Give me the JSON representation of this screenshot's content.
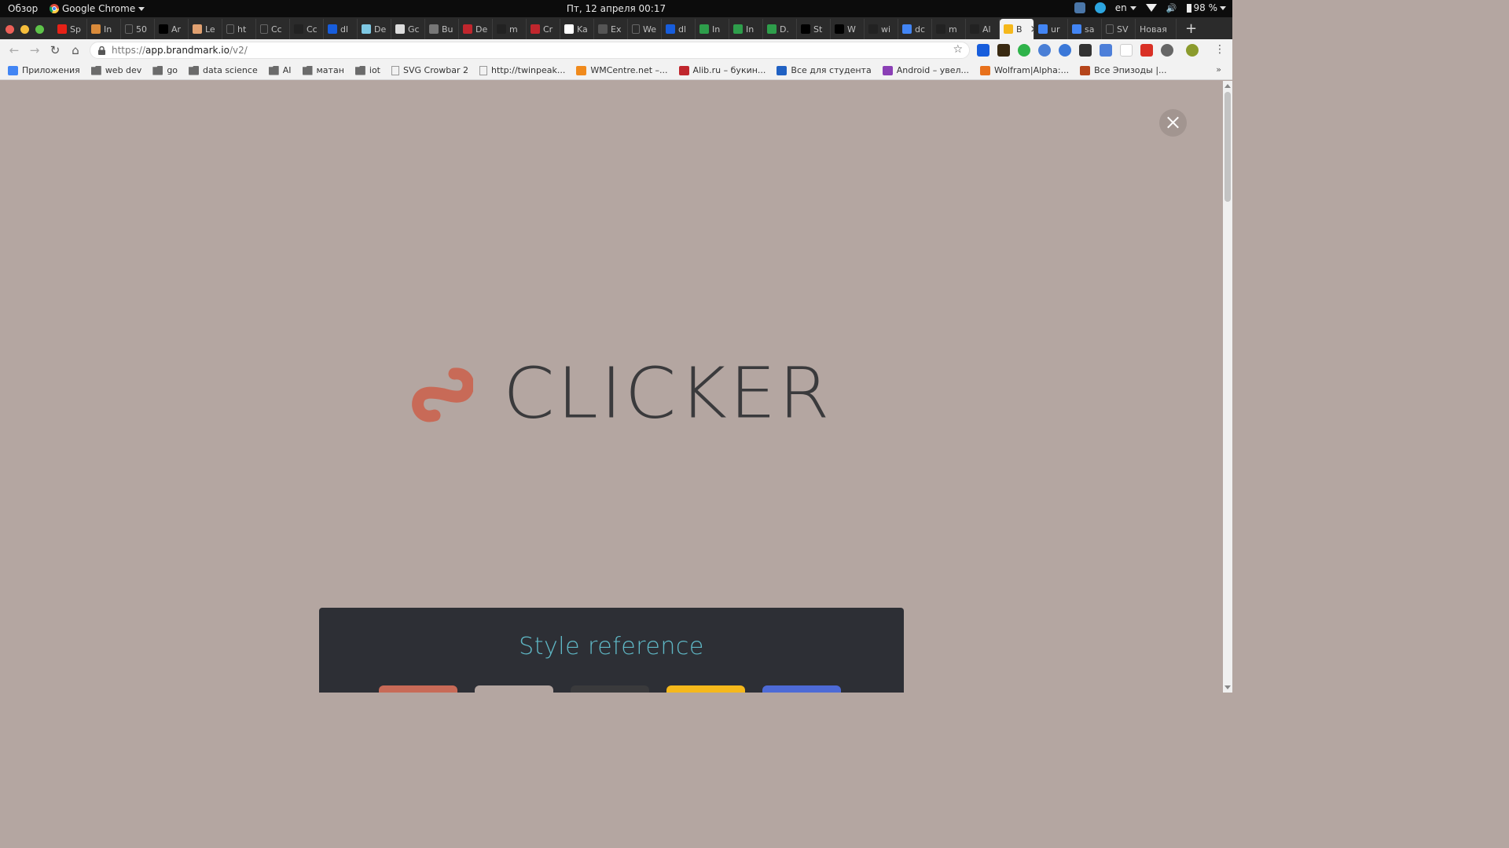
{
  "os": {
    "overview_label": "Обзор",
    "app_name": "Google Chrome",
    "clock": "Пт, 12 апреля  00:17",
    "tray": {
      "lang": "en",
      "battery": "98 %"
    }
  },
  "tabs": [
    {
      "label": "Sp",
      "icon": "youtube-icon",
      "color": "#e62117"
    },
    {
      "label": "In",
      "icon": "emoji-icon",
      "color": "#d98a3a"
    },
    {
      "label": "50",
      "icon": "page-icon",
      "color": "#666666"
    },
    {
      "label": "Ar",
      "icon": "medium-icon",
      "color": "#000000"
    },
    {
      "label": "Le",
      "icon": "emoji-icon",
      "color": "#e0a070"
    },
    {
      "label": "ht",
      "icon": "page-icon",
      "color": "#666666"
    },
    {
      "label": "Cc",
      "icon": "page-icon",
      "color": "#666666"
    },
    {
      "label": "Cc",
      "icon": "github-icon",
      "color": "#222222"
    },
    {
      "label": "dl",
      "icon": "bitwarden-icon",
      "color": "#175ddc"
    },
    {
      "label": "De",
      "icon": "doc-icon",
      "color": "#7ec8e3"
    },
    {
      "label": "Gc",
      "icon": "doc-icon",
      "color": "#dddddd"
    },
    {
      "label": "Bu",
      "icon": "cube-icon",
      "color": "#777777"
    },
    {
      "label": "De",
      "icon": "lips-icon",
      "color": "#c0262d"
    },
    {
      "label": "m",
      "icon": "github-icon",
      "color": "#222222"
    },
    {
      "label": "Cr",
      "icon": "lips-icon",
      "color": "#c0262d"
    },
    {
      "label": "Ka",
      "icon": "t-icon",
      "color": "#ffffff"
    },
    {
      "label": "Ex",
      "icon": "dots-icon",
      "color": "#555555"
    },
    {
      "label": "We",
      "icon": "page-icon",
      "color": "#666666"
    },
    {
      "label": "dl",
      "icon": "bitwarden-icon",
      "color": "#175ddc"
    },
    {
      "label": "In",
      "icon": "leaf-icon",
      "color": "#2e9e4b"
    },
    {
      "label": "In",
      "icon": "leaf-icon",
      "color": "#2e9e4b"
    },
    {
      "label": "D.",
      "icon": "leaf-icon",
      "color": "#2e9e4b"
    },
    {
      "label": "St",
      "icon": "medium-icon",
      "color": "#000000"
    },
    {
      "label": "W",
      "icon": "medium-icon",
      "color": "#000000"
    },
    {
      "label": "wi",
      "icon": "github-icon",
      "color": "#222222"
    },
    {
      "label": "dc",
      "icon": "google-icon",
      "color": "#4285f4"
    },
    {
      "label": "m",
      "icon": "github-icon",
      "color": "#222222"
    },
    {
      "label": "Al",
      "icon": "github-icon",
      "color": "#222222"
    },
    {
      "label": "B",
      "icon": "brandmark-icon",
      "color": "#f5b81b",
      "active": true
    },
    {
      "label": "ur",
      "icon": "google-icon",
      "color": "#4285f4"
    },
    {
      "label": "sa",
      "icon": "google-icon",
      "color": "#4285f4"
    },
    {
      "label": "SV",
      "icon": "page-icon",
      "color": "#666666"
    },
    {
      "label": "Новая",
      "icon": "",
      "color": "",
      "last": true
    }
  ],
  "address": {
    "url_scheme": "https://",
    "url_host": "app.brandmark.io",
    "url_path": "/v2/"
  },
  "bookmarks": [
    {
      "label": "Приложения",
      "icon": "apps-grid-icon"
    },
    {
      "label": "web dev",
      "icon": "folder-icon"
    },
    {
      "label": "go",
      "icon": "folder-icon"
    },
    {
      "label": "data science",
      "icon": "folder-icon"
    },
    {
      "label": "AI",
      "icon": "folder-icon"
    },
    {
      "label": "матан",
      "icon": "folder-icon"
    },
    {
      "label": "iot",
      "icon": "folder-icon"
    },
    {
      "label": "SVG Crowbar 2",
      "icon": "page-icon"
    },
    {
      "label": "http://twinpeak...",
      "icon": "page-icon"
    },
    {
      "label": "WMCentre.net –...",
      "icon": "wmcentre-icon"
    },
    {
      "label": "Alib.ru – букин...",
      "icon": "alib-icon"
    },
    {
      "label": "Все для студента",
      "icon": "t-icon"
    },
    {
      "label": "Android – увел...",
      "icon": "android-icon"
    },
    {
      "label": "Wolfram|Alpha:...",
      "icon": "wolfram-icon"
    },
    {
      "label": "Все Эпизоды |...",
      "icon": "episodes-icon"
    }
  ],
  "page": {
    "logo_text": "CLICKER",
    "panel_title": "Style reference",
    "swatch_colors": [
      "#c86a57",
      "#b4a6a1",
      "#3a3a3c",
      "#f5b81b",
      "#4d6ad6"
    ],
    "logo_color": "#c86a57",
    "background": "#b4a6a1"
  }
}
